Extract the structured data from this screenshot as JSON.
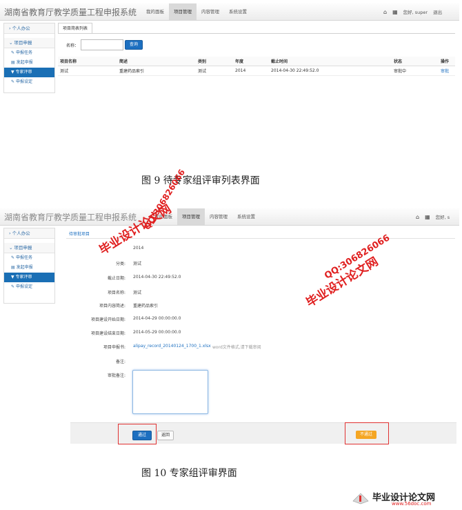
{
  "app": {
    "title": "湖南省教育厅教学质量工程申报系统",
    "nav": [
      "我的面板",
      "项目管理",
      "内容管理",
      "系统设置"
    ],
    "user_greeting": "您好, super",
    "logout": "退出"
  },
  "sidebar": {
    "personal": "个人办公",
    "section": "项目申报",
    "items": [
      "申报任务",
      "发起申报",
      "专家评审",
      "申报设定"
    ]
  },
  "screen1": {
    "tab": "项目简表列表",
    "search_label": "名称：",
    "search_value": "",
    "search_button": "查询",
    "table": {
      "headers": [
        "项目名称",
        "简述",
        "类别",
        "年度",
        "截止时间",
        "状态",
        "操作"
      ],
      "rows": [
        [
          "测试",
          "重建药品索引",
          "测试",
          "2014",
          "2014-04-30 22:49:52.0",
          "审批中",
          "审批"
        ]
      ]
    }
  },
  "caption1": "图 9 待专家组评审列表界面",
  "screen2": {
    "breadcrumb": "待审批项目",
    "year_value": "2014",
    "fields": [
      {
        "label": "分类:",
        "value": "测试"
      },
      {
        "label": "截止日期:",
        "value": "2014-04-30 22:49:52.0"
      },
      {
        "label": "项目名称:",
        "value": "测试"
      },
      {
        "label": "项目内容简述:",
        "value": "重建药品索引"
      },
      {
        "label": "项目建设开始日期:",
        "value": "2014-04-29 00:00:00.0"
      },
      {
        "label": "项目建设结束日期:",
        "value": "2014-05-29 00:00:00.0"
      }
    ],
    "file_label": "项目申报书:",
    "file_name": "alipay_record_20140124_1700_1.xlsx",
    "file_hint": "word文件格式,请下载审阅",
    "remark_label": "备注:",
    "approve_remark_label": "审批备注:",
    "pass_button": "通过",
    "back_button": "返回",
    "reject_button": "不通过"
  },
  "caption2": "图 10 专家组评审界面",
  "watermarks": {
    "site_cn": "毕业设计论文网",
    "site_url": "www.56doc.com",
    "qq": "QQ:306826066"
  },
  "footer_logo": {
    "title": "毕业设计论文网",
    "url": "www.56doc.com"
  }
}
